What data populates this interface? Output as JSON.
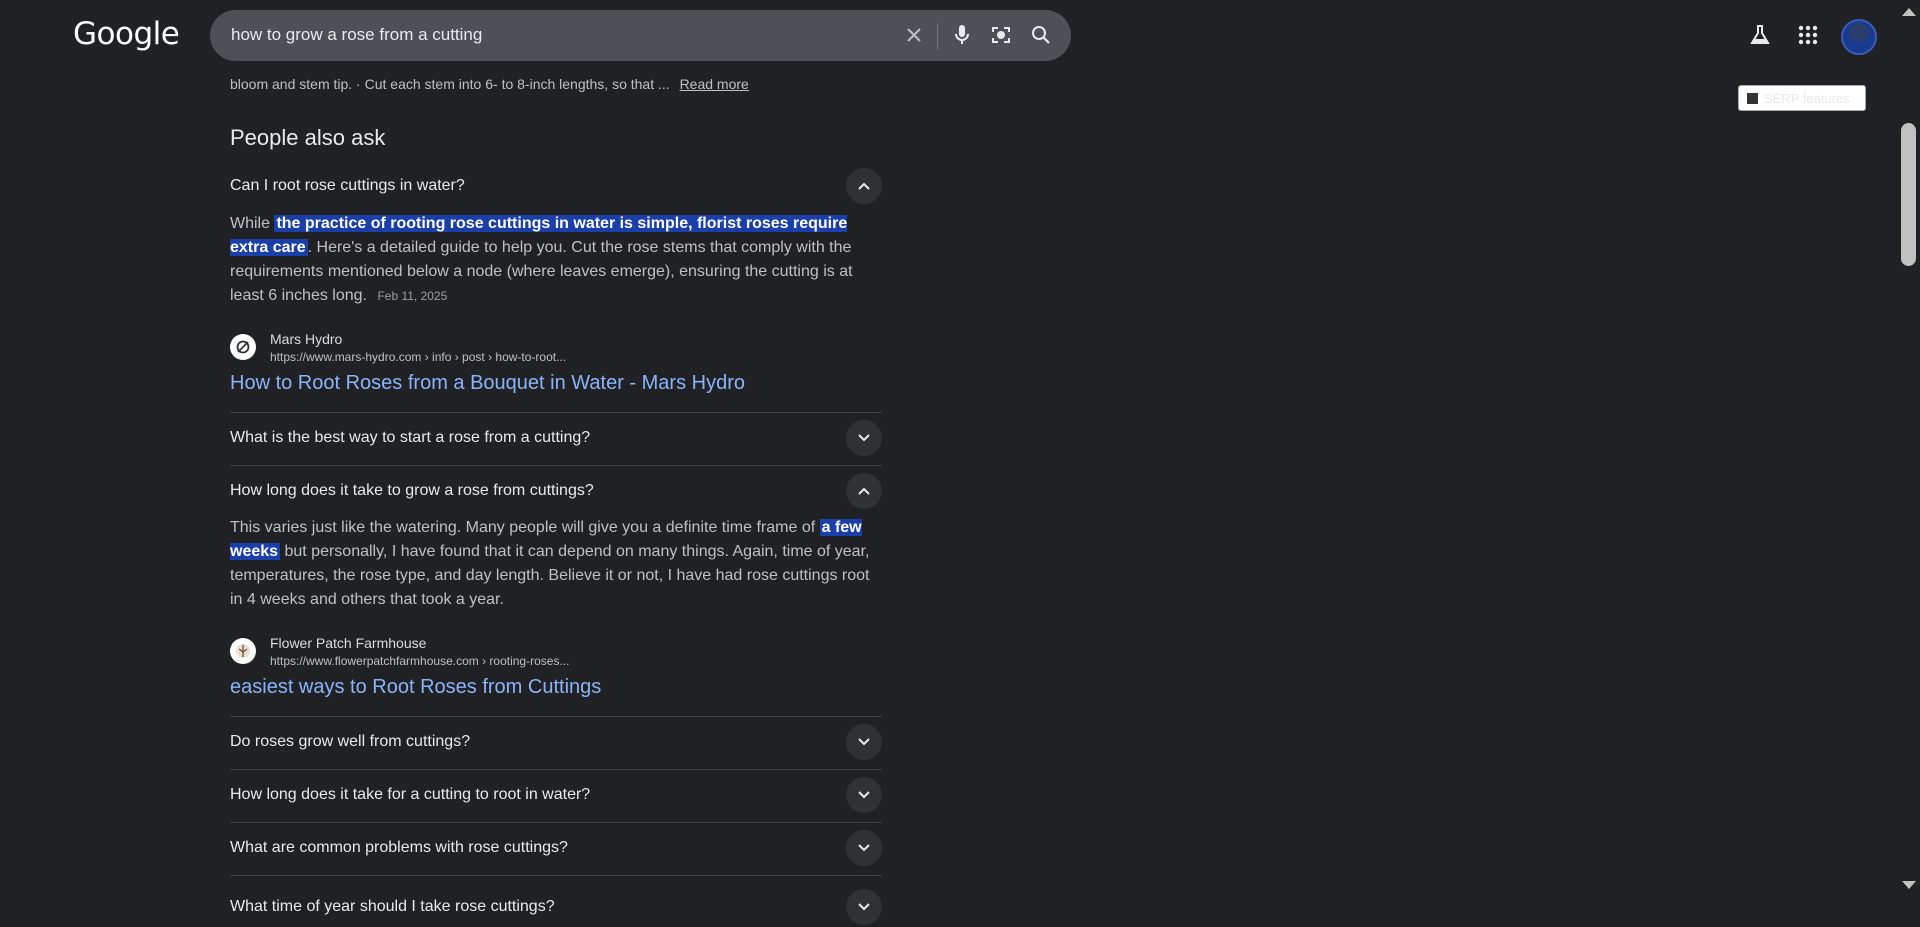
{
  "header": {
    "logo_text": "Google",
    "search_query": "how to grow a rose from a cutting",
    "serp_features_label": "SERP features"
  },
  "icons": {
    "clear": "close-icon",
    "voice": "microphone-icon",
    "lens": "camera-lens-icon",
    "search": "search-icon",
    "labs": "flask-icon",
    "apps": "apps-grid-icon",
    "account": "avatar"
  },
  "results": {
    "snippet_text": "bloom and stem tip. · Cut each stem into 6- to 8-inch lengths, so that ...",
    "read_more": "Read more"
  },
  "paa": {
    "title": "People also ask",
    "questions": [
      {
        "question": "Can I root rose cuttings in water?",
        "expanded": true,
        "answer_lead": "While ",
        "answer_highlight": "the practice of rooting rose cuttings in water is simple, florist roses require extra care",
        "answer_rest": ". Here's a detailed guide to help you. Cut the rose stems that comply with the requirements mentioned below a node (where leaves emerge), ensuring the cutting is at least 6 inches long.",
        "date": "Feb 11, 2025",
        "source_name": "Mars Hydro",
        "source_url": "https://www.mars-hydro.com › info › post › how-to-root...",
        "source_title": "How to Root Roses from a Bouquet in Water - Mars Hydro"
      },
      {
        "question": "What is the best way to start a rose from a cutting?",
        "expanded": false
      },
      {
        "question": "How long does it take to grow a rose from cuttings?",
        "expanded": true,
        "answer_lead": "This varies just like the watering. Many people will give you a definite time frame of ",
        "answer_highlight": "a few weeks",
        "answer_rest": " but personally, I have found that it can depend on many things. Again, time of year, temperatures, the rose type, and day length. Believe it or not, I have had rose cuttings root in 4 weeks and others that took a year.",
        "source_name": "Flower Patch Farmhouse",
        "source_url": "https://www.flowerpatchfarmhouse.com › rooting-roses...",
        "source_title": "easiest ways to Root Roses from Cuttings"
      },
      {
        "question": "Do roses grow well from cuttings?",
        "expanded": false
      },
      {
        "question": "How long does it take for a cutting to root in water?",
        "expanded": false
      },
      {
        "question": "What are common problems with rose cuttings?",
        "expanded": false
      },
      {
        "question": "What time of year should I take rose cuttings?",
        "expanded": false
      }
    ]
  },
  "colors": {
    "background": "#202124",
    "link": "#8ab4f8",
    "highlight": "#1a3fa8"
  }
}
